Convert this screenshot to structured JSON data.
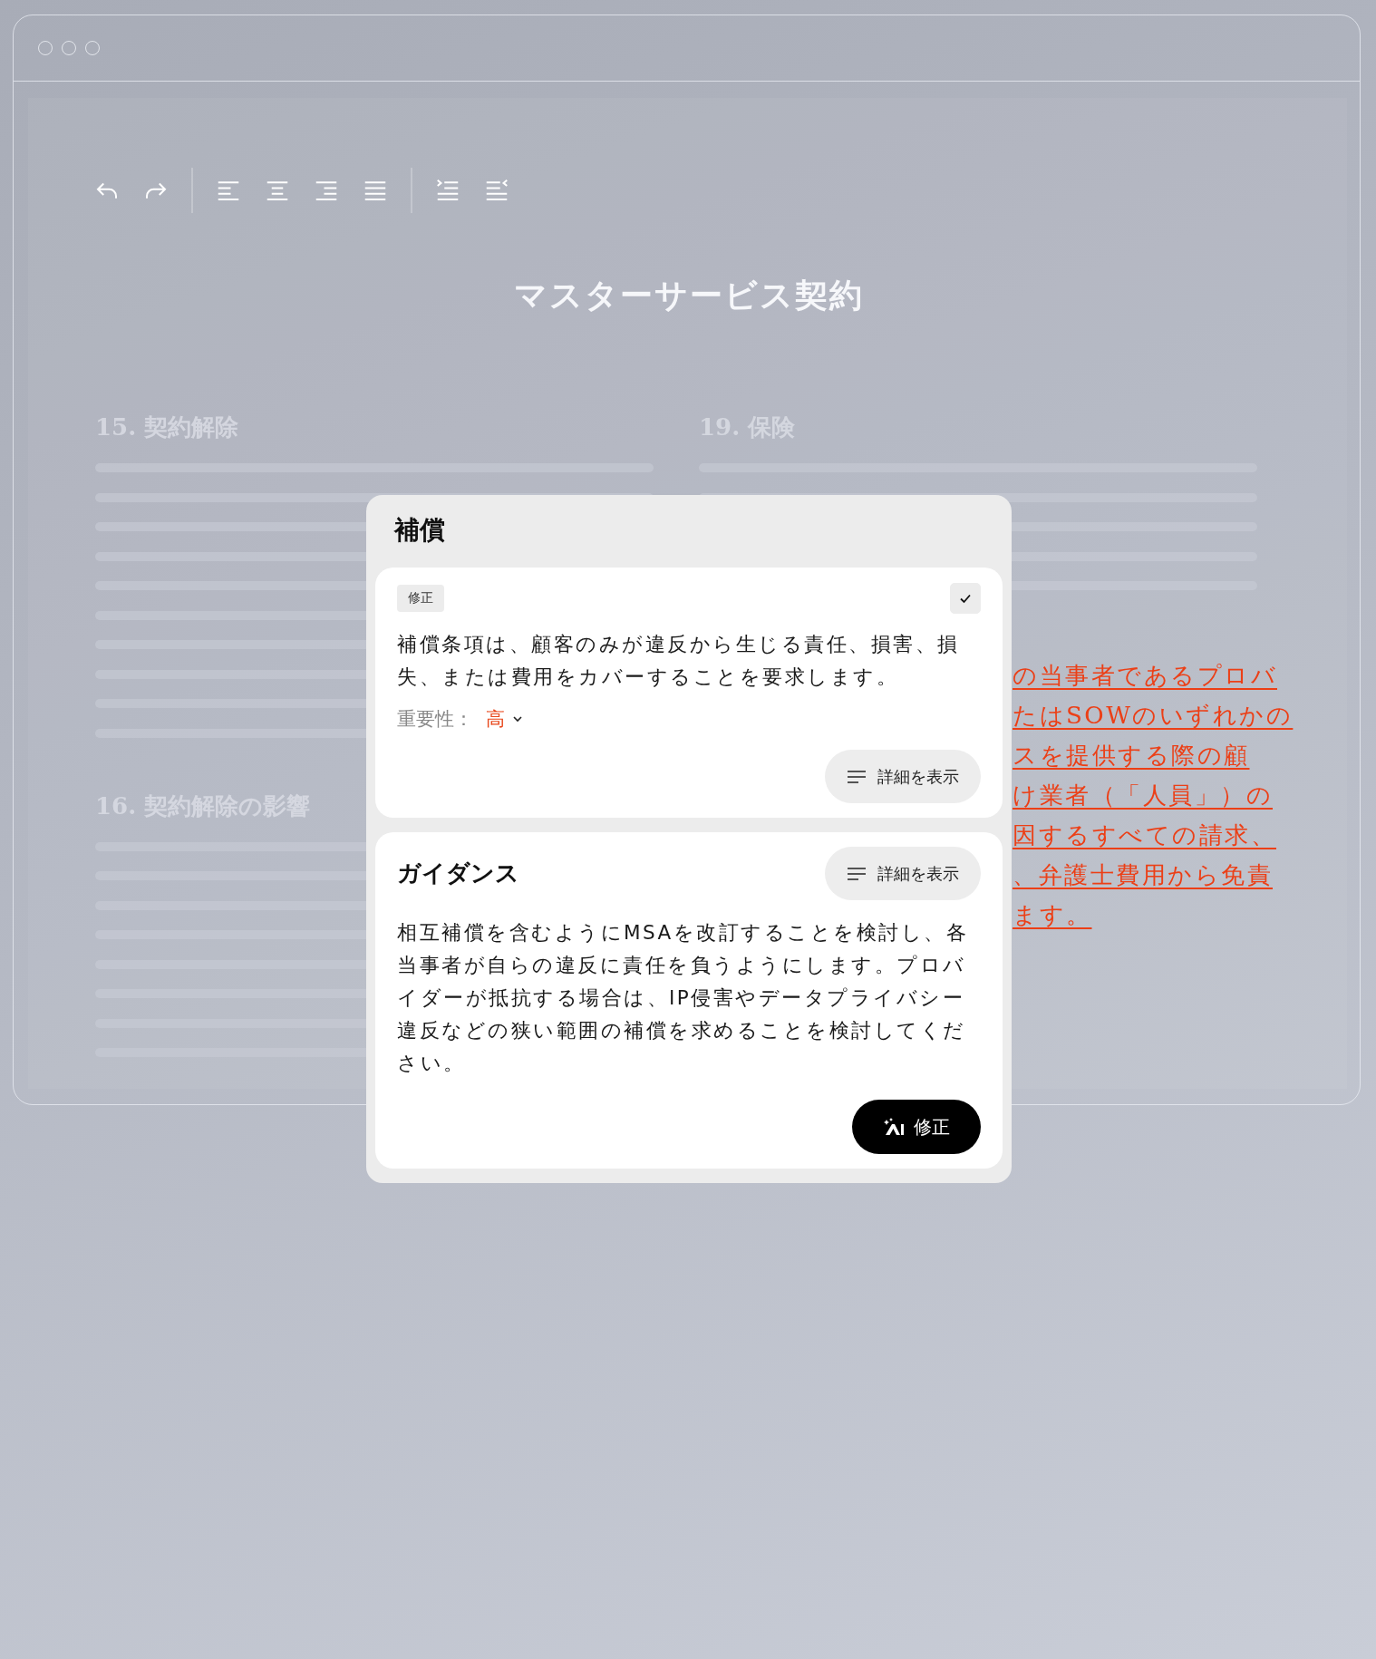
{
  "toolbar": {
    "buttons": [
      {
        "kind": "undo"
      },
      {
        "kind": "redo"
      },
      {
        "kind": "separator"
      },
      {
        "kind": "align-left"
      },
      {
        "kind": "align-center"
      },
      {
        "kind": "align-right"
      },
      {
        "kind": "justify"
      },
      {
        "kind": "separator"
      },
      {
        "kind": "indent"
      },
      {
        "kind": "outdent"
      }
    ]
  },
  "document": {
    "title": "マスターサービス契約",
    "left_sections": [
      {
        "heading": "15. 契約解除"
      },
      {
        "heading": "16. 契約解除の影響"
      }
    ],
    "right_section": {
      "heading": "19. 保険"
    },
    "redline": [
      "の当事者であるプロバ",
      "たはSOWのいずれかの",
      "スを提供する際の顧",
      "け業者（「人員」）の",
      "因するすべての請求、",
      "、弁護士費用から免責",
      "ます。"
    ]
  },
  "panel": {
    "title": "補償",
    "issue": {
      "tag": "修正",
      "checked": true,
      "text": "補償条項は、顧客のみが違反から生じる責任、損害、損失、または費用をカバーすることを要求します。",
      "severity_label": "重要性：",
      "severity": "高",
      "details_button": "詳細を表示"
    },
    "guidance": {
      "title": "ガイダンス",
      "details_button": "詳細を表示",
      "text": "相互補償を含むようにMSAを改訂することを検討し、各当事者が自らの違反に責任を負うようにします。プロバイダーが抵抗する場合は、IP侵害やデータプライバシー違反などの狭い範囲の補償を求めることを検討してください。",
      "apply_button": "修正"
    }
  }
}
